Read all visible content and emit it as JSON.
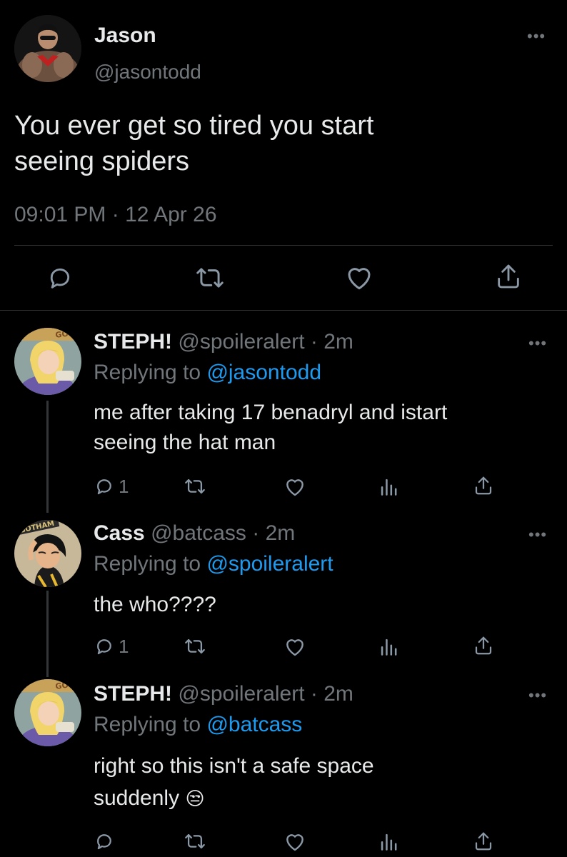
{
  "main_tweet": {
    "display_name": "Jason",
    "handle": "@jasontodd",
    "text_line1": "You ever get so tired you start",
    "text_line2": "seeing spiders",
    "timestamp": "09:01 PM · 12 Apr 26"
  },
  "replies": [
    {
      "display_name": "STEPH!",
      "handle_time": "@spoileralert · 2m",
      "replying_prefix": "Replying to",
      "replying_to": "@jasontodd",
      "text_line1": "me after taking 17 benadryl and istart",
      "text_line2": "seeing the hat man",
      "reply_count": "1"
    },
    {
      "display_name": "Cass",
      "handle_time": "@batcass · 2m",
      "replying_prefix": "Replying to",
      "replying_to": "@spoileralert",
      "text_line1": "the who????",
      "reply_count": "1"
    },
    {
      "display_name": "STEPH!",
      "handle_time": "@spoileralert · 2m",
      "replying_prefix": "Replying to",
      "replying_to": "@batcass",
      "text_line1": "right so this isn't a safe space",
      "text_line2": "suddenly",
      "emoji": "😒"
    }
  ],
  "avatar_texts": {
    "steph_sign": "GOTHAM",
    "cass_sign": "GOTHAM"
  },
  "colors": {
    "background": "#000000",
    "text": "#e7e9ea",
    "secondary": "#71767b",
    "link": "#1d9bf0",
    "divider": "#2f3336"
  }
}
